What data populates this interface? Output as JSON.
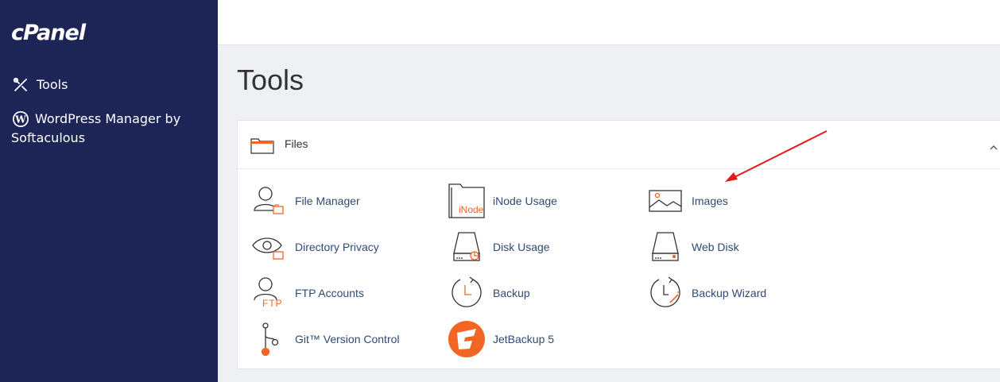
{
  "sidebar": {
    "logo": "cPanel",
    "items": [
      {
        "label": "Tools",
        "icon": "tools-icon"
      },
      {
        "label": "WordPress Manager by Softaculous",
        "icon": "wordpress-icon"
      }
    ]
  },
  "main": {
    "title": "Tools",
    "section": {
      "title": "Files",
      "tools": [
        {
          "label": "File Manager",
          "icon": "file-manager-icon"
        },
        {
          "label": "iNode Usage",
          "icon": "inode-usage-icon",
          "icon_text": "iNode"
        },
        {
          "label": "Images",
          "icon": "images-icon"
        },
        {
          "label": "Directory Privacy",
          "icon": "directory-privacy-icon"
        },
        {
          "label": "Disk Usage",
          "icon": "disk-usage-icon"
        },
        {
          "label": "Web Disk",
          "icon": "web-disk-icon"
        },
        {
          "label": "FTP Accounts",
          "icon": "ftp-accounts-icon",
          "icon_text": "FTP"
        },
        {
          "label": "Backup",
          "icon": "backup-icon"
        },
        {
          "label": "Backup Wizard",
          "icon": "backup-wizard-icon"
        },
        {
          "label": "Git™ Version Control",
          "icon": "git-icon"
        },
        {
          "label": "JetBackup 5",
          "icon": "jetbackup-icon"
        }
      ]
    }
  },
  "colors": {
    "sidebar_bg": "#1d2556",
    "link": "#2f4a74",
    "accent_orange": "#f26522",
    "annotation_arrow": "#e01b1b"
  }
}
